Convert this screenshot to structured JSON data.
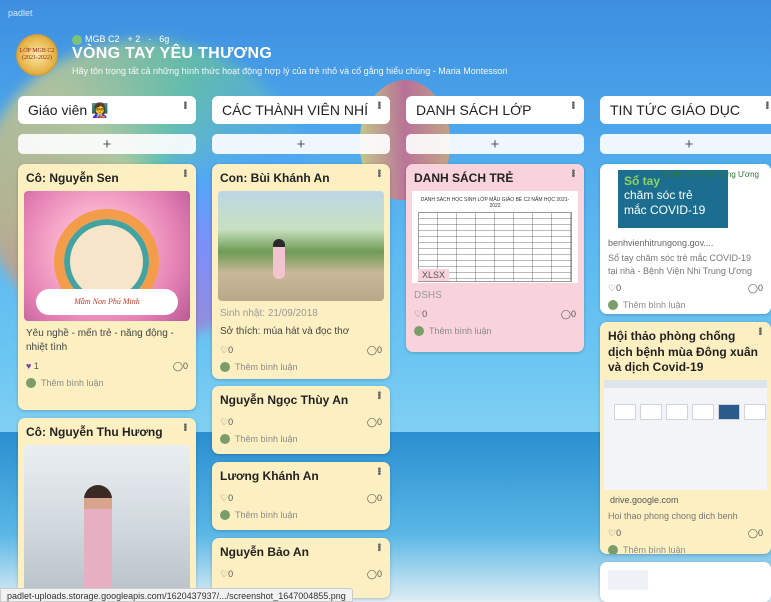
{
  "app": {
    "brand": "padlet"
  },
  "board": {
    "logo_lines": [
      "LỚP MGB C2",
      "(2021-2022)"
    ],
    "meta": {
      "author": "MGB C2",
      "plus": "+ 2",
      "sep": "·",
      "age": "6g"
    },
    "title": "VÒNG TAY YÊU THƯƠNG",
    "subtitle": "Hãy tôn trọng tất cả những hình thức hoạt động hợp lý của trẻ nhỏ và cố gắng hiểu chúng - Maria Montessori"
  },
  "columns": [
    {
      "title": "Giáo viên 👩‍🏫"
    },
    {
      "title": "CÁC THÀNH VIÊN NHÍ"
    },
    {
      "title": "DANH SÁCH LỚP"
    },
    {
      "title": "TIN TỨC GIÁO DỤC"
    }
  ],
  "add_label": "+",
  "comment_label": "Thêm bình luận",
  "cards": {
    "sen": {
      "title": "Cô: Nguyễn Sen",
      "caption": "Mầm Non Phú Minh",
      "body": "Yêu nghề - mến trẻ - năng động - nhiệt tình",
      "likes": "1",
      "comments": "0"
    },
    "huong": {
      "title": "Cô: Nguyễn Thu Hương"
    },
    "an": {
      "title": "Con: Bùi Khánh An",
      "meta": "Sinh nhật: 21/09/2018",
      "body": "Sở thích: múa hát và đọc thơ",
      "likes": "0",
      "comments": "0"
    },
    "thuy_an": {
      "title": "Nguyễn Ngọc Thùy An",
      "likes": "0",
      "comments": "0"
    },
    "khanh_an": {
      "title": "Lương Khánh An",
      "likes": "0",
      "comments": "0"
    },
    "bao_an": {
      "title": "Nguyễn Bảo An",
      "likes": "0",
      "comments": "0"
    },
    "list": {
      "title": "DANH SÁCH TRẺ",
      "sheet_title": "DANH SÁCH HỌC SINH LỚP MẪU GIÁO BÉ C2 NĂM HỌC 2021-2022",
      "tag": "XLSX",
      "body": "DSHS",
      "likes": "0",
      "comments": "0"
    },
    "covid": {
      "img_line1": "Sổ tay",
      "img_line2": "chăm sóc trẻ",
      "img_line3": "mắc COVID-19",
      "img_org": "Bệnh viện Nhi Trung Ương",
      "domain": "benhvienhitrungong.gov....",
      "body": "Sổ tay chăm sóc trẻ mắc COVID-19 tại nhà - Bệnh Viện Nhi Trung Ương",
      "likes": "0",
      "comments": "0"
    },
    "seminar": {
      "title": "Hội thảo phòng chống dịch bệnh mùa Đông xuân và dịch Covid-19",
      "domain": "drive.google.com",
      "body": "Hoi thao phong chong dich benh",
      "likes": "0",
      "comments": "0"
    }
  },
  "status_url": "padlet-uploads.storage.googleapis.com/1620437937/.../screenshot_1647004855.png",
  "colors": {
    "yellow_card": "#fcf0c2",
    "pink_card": "#f9d3dc",
    "accent_heart": "#7a3aa8"
  }
}
